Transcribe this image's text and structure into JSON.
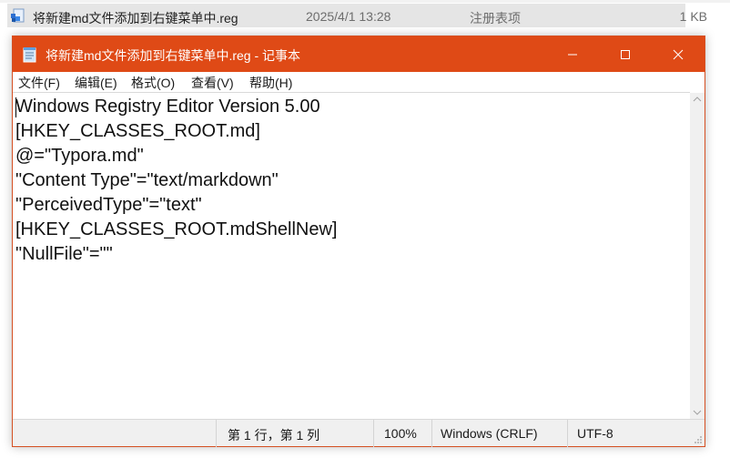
{
  "explorer": {
    "file_name": "将新建md文件添加到右键菜单中.reg",
    "modified": "2025/4/1 13:28",
    "type": "注册表项",
    "size": "1 KB"
  },
  "window": {
    "title": "将新建md文件添加到右键菜单中.reg - 记事本",
    "accent_color": "#df4a16"
  },
  "menu": [
    "文件(F)",
    "编辑(E)",
    "格式(O)",
    "查看(V)",
    "帮助(H)"
  ],
  "editor": {
    "lines": [
      "Windows Registry Editor Version 5.00",
      "[HKEY_CLASSES_ROOT.md]",
      "@=\"Typora.md\"",
      "\"Content Type\"=\"text/markdown\"",
      "\"PerceivedType\"=\"text\"",
      "[HKEY_CLASSES_ROOT.mdShellNew]",
      "\"NullFile\"=\"\""
    ]
  },
  "status": {
    "position": "第 1 行，第 1 列",
    "zoom": "100%",
    "line_ending": "Windows (CRLF)",
    "encoding": "UTF-8"
  }
}
